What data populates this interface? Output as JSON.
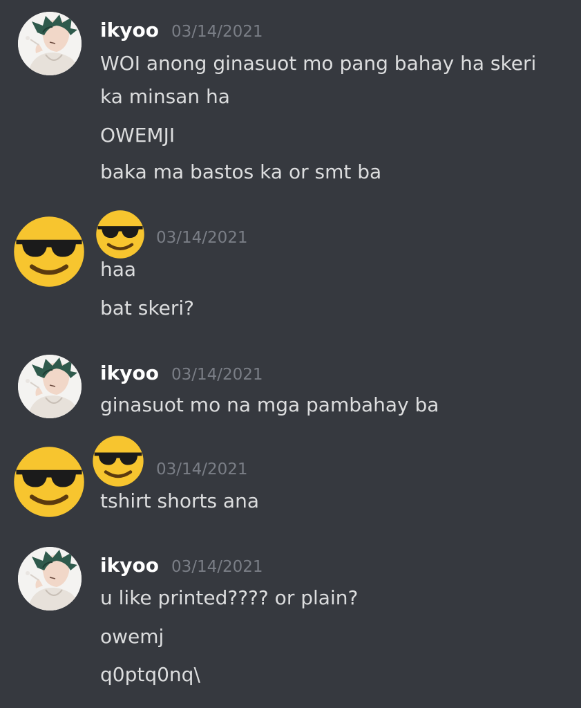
{
  "groups": [
    {
      "author": "ikyoo",
      "timestamp": "03/14/2021",
      "messages": [
        "WOI anong ginasuot mo pang bahay ha skeri",
        "ka minsan ha",
        "OWEMJI",
        "baka ma bastos ka or smt ba"
      ]
    },
    {
      "author_icon": "sunglasses-emoji-icon",
      "timestamp": "03/14/2021",
      "messages": [
        "haa",
        "bat skeri?"
      ]
    },
    {
      "author": "ikyoo",
      "timestamp": "03/14/2021",
      "messages": [
        "ginasuot mo na mga pambahay ba"
      ]
    },
    {
      "author_icon": "sunglasses-emoji-icon",
      "timestamp": "03/14/2021",
      "messages": [
        "tshirt shorts ana"
      ]
    },
    {
      "author": "ikyoo",
      "timestamp": "03/14/2021",
      "messages": [
        "u like printed???? or plain?",
        "owemj",
        "q0ptq0nq\\"
      ]
    }
  ],
  "colors": {
    "background": "#36393f",
    "username": "#ffffff",
    "message_text": "#dcddde",
    "timestamp": "#7a7e86",
    "emoji_face": "#f7c52f"
  }
}
